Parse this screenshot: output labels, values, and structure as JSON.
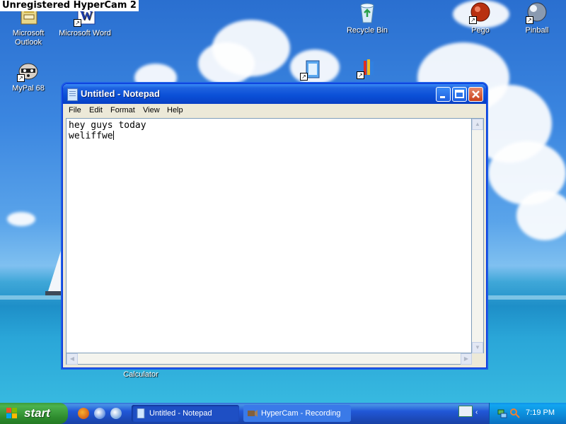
{
  "watermark": "Unregistered HyperCam 2",
  "desktop_icons": {
    "outlook": {
      "label_line1": "Microsoft",
      "label_line2": "Outlook"
    },
    "word": {
      "label": "Microsoft Word"
    },
    "recycle": {
      "label": "Recycle Bin"
    },
    "pego": {
      "label": "Pego"
    },
    "pinball": {
      "label": "Pinball"
    },
    "mypal": {
      "label": "MyPal 68"
    },
    "calculator": {
      "label": "Calculator"
    }
  },
  "notepad": {
    "title": "Untitled - Notepad",
    "menu": [
      "File",
      "Edit",
      "Format",
      "View",
      "Help"
    ],
    "content_line1": "hey guys today",
    "content_line2": "weliffwe",
    "buttons": {
      "minimize": "_",
      "maximize": "□",
      "close": "✕"
    }
  },
  "taskbar": {
    "start_label": "start",
    "tasks": [
      {
        "label": "Untitled - Notepad",
        "icon": "notepad-icon",
        "active": true
      },
      {
        "label": "HyperCam - Recording",
        "icon": "hypercam-icon",
        "active": false
      }
    ],
    "quick_launch": [
      "firefox-icon",
      "ie-icon",
      "media-player-icon"
    ],
    "clock": "7:19 PM"
  },
  "colors": {
    "titlebar": "#0a4fd6",
    "start_button": "#2e8b2e",
    "taskbar": "#2157d7",
    "tray": "#0c8ad8"
  }
}
